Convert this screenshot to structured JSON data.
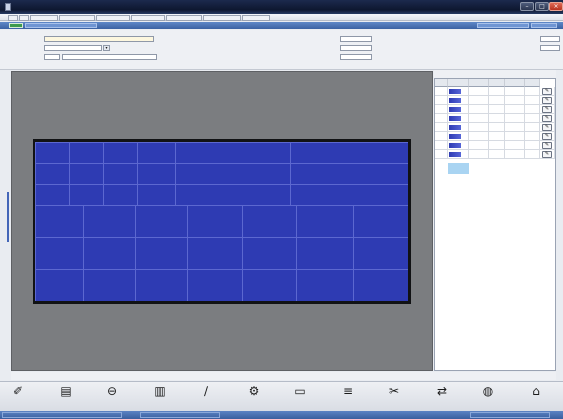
{
  "window": {
    "title": ""
  },
  "menu": {
    "tabs": [
      "",
      "",
      "",
      "",
      "",
      "",
      "",
      "",
      ""
    ]
  },
  "blue_bar": {
    "center_title": ""
  },
  "form": {
    "left": [
      {
        "label": "",
        "value": "",
        "selected": true
      },
      {
        "label": "",
        "value": ""
      },
      {
        "label": "",
        "qty": "",
        "value": ""
      }
    ],
    "right": [
      {
        "label": "",
        "value": ""
      },
      {
        "label": "",
        "value": ""
      },
      {
        "label": "",
        "value": ""
      }
    ],
    "far_right": [
      {
        "label": "",
        "value": ""
      },
      {
        "label": "",
        "value": ""
      }
    ]
  },
  "layout": {
    "top_rows": [
      {
        "cells": [
          "",
          "",
          "",
          ""
        ],
        "wide": [
          "",
          ""
        ]
      },
      {
        "cells": [
          "",
          "",
          "",
          ""
        ],
        "wide": [
          "",
          ""
        ]
      },
      {
        "cells": [
          "",
          "",
          "",
          ""
        ],
        "wide": [
          "",
          ""
        ]
      }
    ],
    "bottom_rows": [
      {
        "cells": [
          "",
          "",
          "",
          "",
          "",
          "",
          ""
        ]
      },
      {
        "cells": [
          "",
          "",
          "",
          "",
          "",
          "",
          ""
        ]
      },
      {
        "cells": [
          "",
          "",
          "",
          "",
          "",
          "",
          ""
        ]
      }
    ]
  },
  "grid": {
    "header_title": "",
    "columns": [
      "",
      "",
      "",
      "",
      "",
      ""
    ],
    "rows": [
      {
        "index": "",
        "code": "",
        "l": "",
        "w": "",
        "qty": "",
        "price": ""
      },
      {
        "index": "",
        "code": "",
        "l": "",
        "w": "",
        "qty": "",
        "price": ""
      },
      {
        "index": "",
        "code": "",
        "l": "",
        "w": "",
        "qty": "",
        "price": ""
      },
      {
        "index": "",
        "code": "",
        "l": "",
        "w": "",
        "qty": "",
        "price": ""
      },
      {
        "index": "",
        "code": "",
        "l": "",
        "w": "",
        "qty": "",
        "price": ""
      },
      {
        "index": "",
        "code": "",
        "l": "",
        "w": "",
        "qty": "",
        "price": ""
      },
      {
        "index": "",
        "code": "",
        "l": "",
        "w": "",
        "qty": "",
        "price": ""
      },
      {
        "index": "",
        "code": "",
        "l": "",
        "w": "",
        "qty": "",
        "price": ""
      }
    ],
    "edit_glyph": "✎"
  },
  "status_line": {
    "left_a": "",
    "left_b": "",
    "left_c": "",
    "right": ""
  },
  "toolbar": [
    {
      "icon": "pin-icon",
      "glyph": "✐",
      "label": ""
    },
    {
      "icon": "printer-icon",
      "glyph": "▤",
      "label": ""
    },
    {
      "icon": "stop-icon",
      "glyph": "⊖",
      "label": ""
    },
    {
      "icon": "book-icon",
      "glyph": "▥",
      "label": ""
    },
    {
      "icon": "tool-icon",
      "glyph": "∕",
      "label": ""
    },
    {
      "icon": "machine-icon",
      "glyph": "⚙",
      "label": ""
    },
    {
      "icon": "panel-icon",
      "glyph": "▭",
      "label": ""
    },
    {
      "icon": "layers-icon",
      "glyph": "≡",
      "label": ""
    },
    {
      "icon": "cutter-icon",
      "glyph": "✂",
      "label": ""
    },
    {
      "icon": "arrows-icon",
      "glyph": "⇄",
      "label": ""
    },
    {
      "icon": "globe-icon",
      "glyph": "◍",
      "label": ""
    },
    {
      "icon": "home-icon",
      "glyph": "⌂",
      "label": ""
    }
  ],
  "status_bar": {
    "left": "",
    "middle": "",
    "right": ""
  },
  "colors": {
    "board": "#2e3bb3",
    "title_bar": "#0e1730",
    "blue_bar": "#3b62a3",
    "canvas": "#7b7d80"
  }
}
